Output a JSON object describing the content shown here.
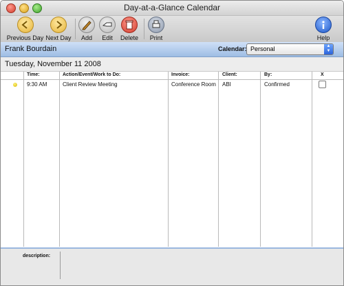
{
  "window": {
    "title": "Day-at-a-Glance Calendar"
  },
  "toolbar": {
    "previous_day": "Previous Day",
    "next_day": "Next Day",
    "add": "Add",
    "edit": "Edit",
    "delete": "Delete",
    "print": "Print",
    "help": "Help"
  },
  "userbar": {
    "user_name": "Frank Bourdain",
    "calendar_label": "Calendar:",
    "calendar_value": "Personal"
  },
  "date": "Tuesday, November 11 2008",
  "table": {
    "headers": [
      "Time:",
      "Action/Event/Work to Do:",
      "Invoice:",
      "Client:",
      "By:",
      "X"
    ],
    "rows": [
      {
        "time": "9:30 AM",
        "action": "Client Review Meeting",
        "invoice": "Conference Room",
        "client": "ABI",
        "by": "Confirmed"
      }
    ]
  },
  "description": {
    "label": "description:"
  }
}
